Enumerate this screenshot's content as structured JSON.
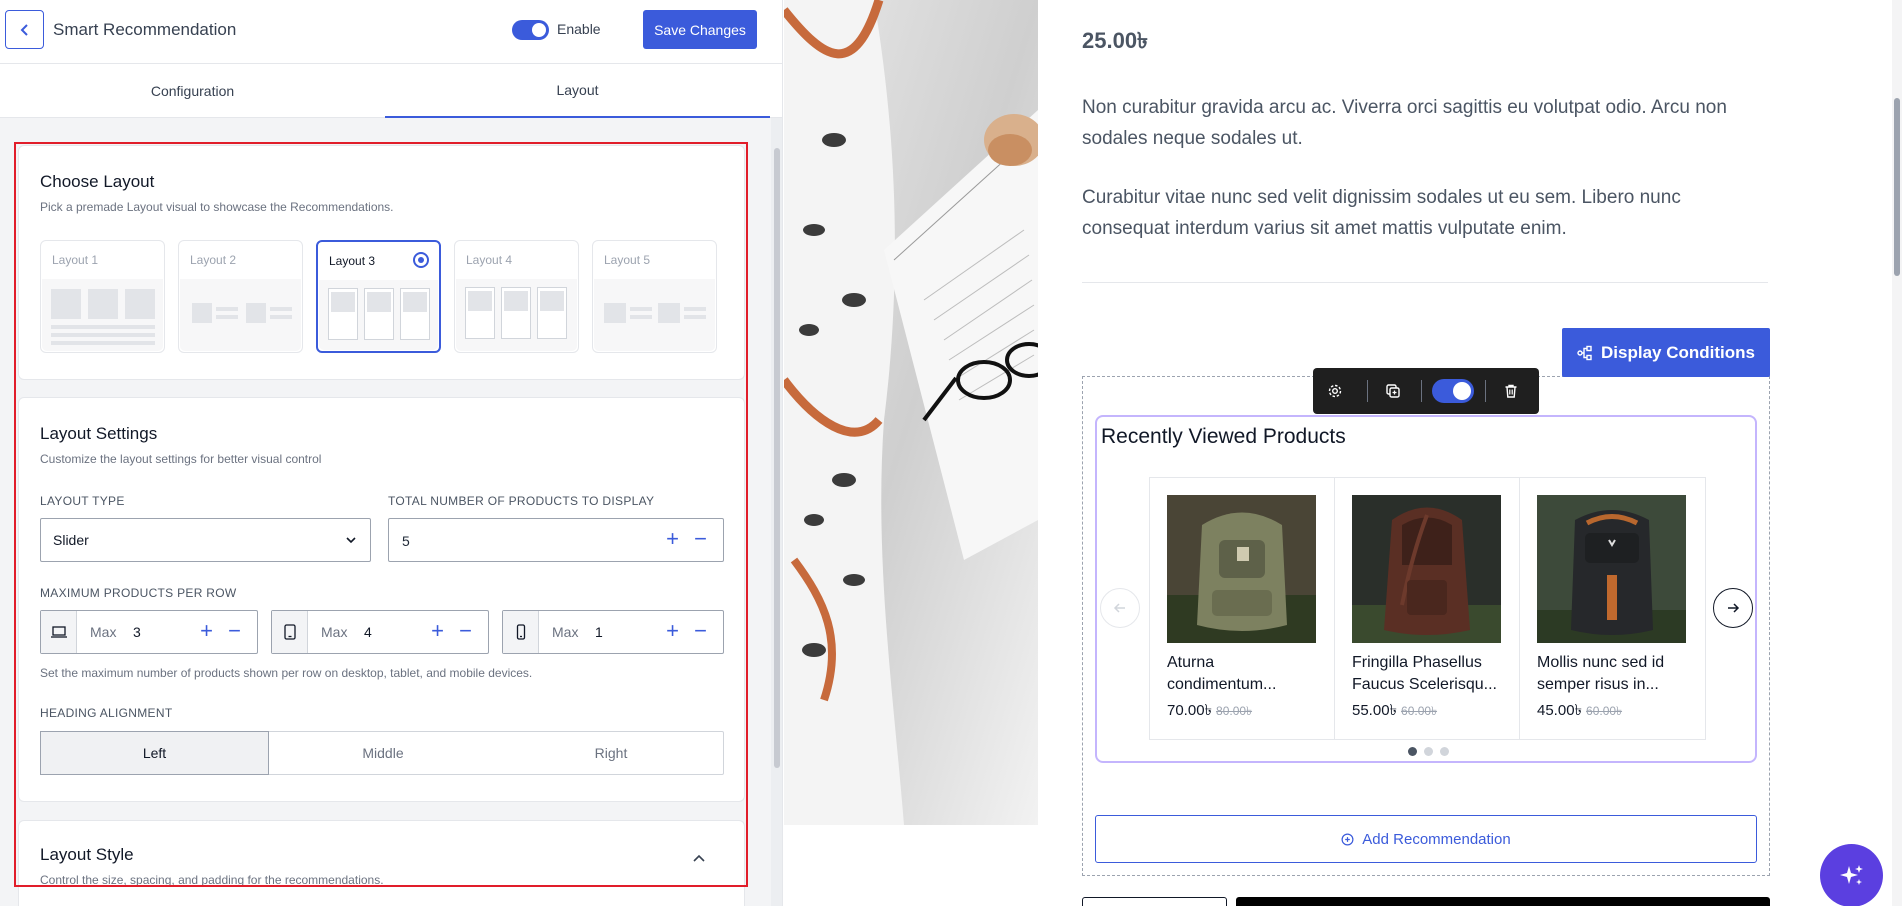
{
  "header": {
    "title": "Smart Recommendation",
    "enable_label": "Enable",
    "save_label": "Save Changes"
  },
  "tabs": [
    {
      "label": "Configuration",
      "active": false
    },
    {
      "label": "Layout",
      "active": true
    }
  ],
  "choose_layout": {
    "title": "Choose Layout",
    "subtitle": "Pick a premade Layout visual to showcase the Recommendations.",
    "options": [
      {
        "label": "Layout 1",
        "selected": false
      },
      {
        "label": "Layout 2",
        "selected": false
      },
      {
        "label": "Layout 3",
        "selected": true
      },
      {
        "label": "Layout 4",
        "selected": false
      },
      {
        "label": "Layout 5",
        "selected": false
      }
    ]
  },
  "layout_settings": {
    "title": "Layout Settings",
    "subtitle": "Customize the layout settings for better visual control",
    "layout_type_label": "LAYOUT TYPE",
    "layout_type_value": "Slider",
    "total_label": "TOTAL NUMBER OF PRODUCTS TO DISPLAY",
    "total_value": "5",
    "per_row_label": "MAXIMUM PRODUCTS PER ROW",
    "max_label": "Max",
    "desktop_value": "3",
    "tablet_value": "4",
    "mobile_value": "1",
    "per_row_help": "Set the maximum number of products shown per row on desktop, tablet, and mobile devices.",
    "alignment_label": "HEADING ALIGNMENT",
    "alignment_options": [
      "Left",
      "Middle",
      "Right"
    ],
    "alignment_selected": "Left"
  },
  "layout_style": {
    "title": "Layout Style",
    "subtitle": "Control the size, spacing, and padding for the recommendations."
  },
  "preview": {
    "price": "25.00৳",
    "para1": "Non curabitur gravida arcu ac. Viverra orci sagittis eu volutpat odio. Arcu non sodales neque sodales ut.",
    "para2": "Curabitur vitae nunc sed velit dignissim sodales ut eu sem. Libero nunc consequat interdum varius sit amet mattis vulputate enim.",
    "display_conditions_label": "Display Conditions",
    "widget_title": "Recently Viewed Products",
    "products": [
      {
        "name": "Aturna condimentum...",
        "price": "70.00৳",
        "old_price": "80.00৳"
      },
      {
        "name": "Fringilla Phasellus Faucus Scelerisqu...",
        "price": "55.00৳",
        "old_price": "60.00৳"
      },
      {
        "name": "Mollis nunc sed id semper risus in...",
        "price": "45.00৳",
        "old_price": "60.00৳"
      }
    ],
    "add_recommendation_label": "Add Recommendation"
  },
  "icons": {
    "back": "chevron-left-icon",
    "gear": "gear-icon",
    "duplicate": "duplicate-icon",
    "trash": "trash-icon",
    "sitemap": "sitemap-icon",
    "sparkle": "sparkle-icon"
  },
  "colors": {
    "accent": "#3b5bdb",
    "highlight_outline": "#e11d2a",
    "widget_border": "#c4b5fd"
  }
}
